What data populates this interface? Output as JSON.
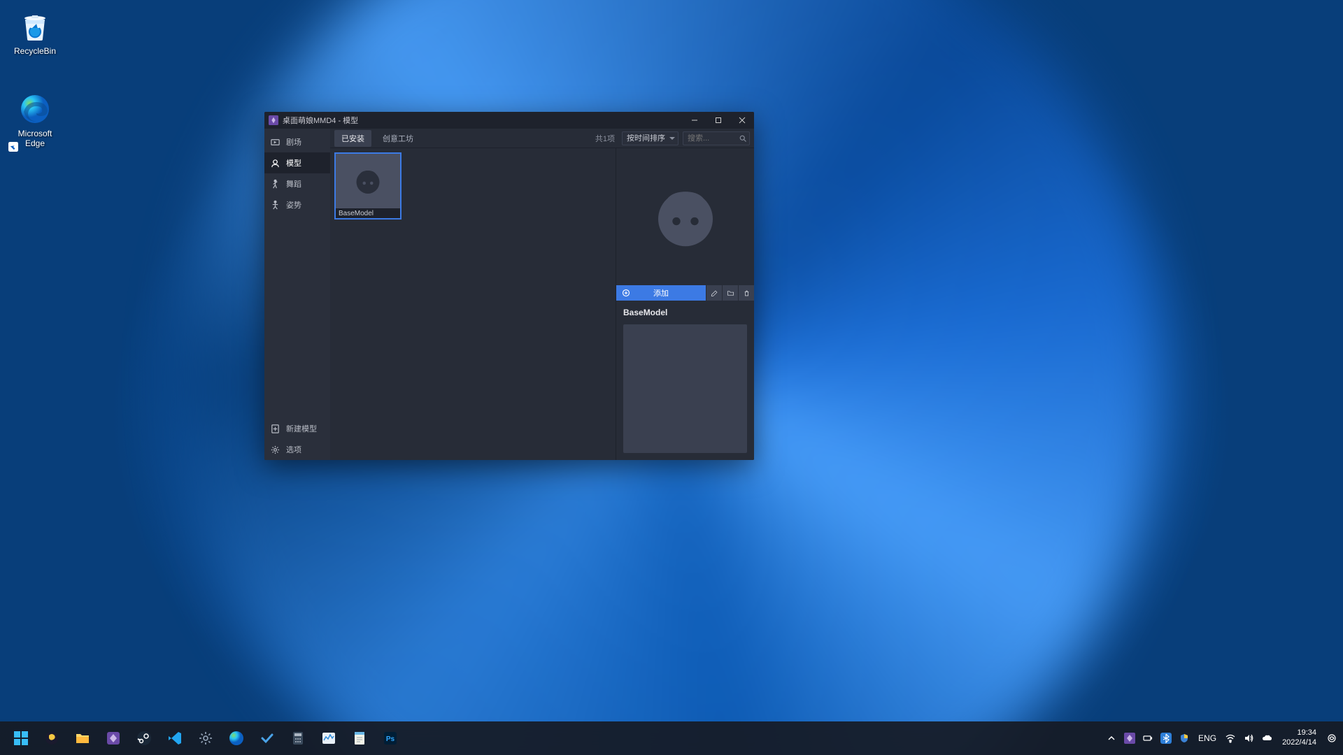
{
  "desktop": {
    "recycle_bin": "RecycleBin",
    "edge": "Microsoft Edge"
  },
  "window": {
    "title": "桌面萌娘MMD4 - 模型",
    "sidebar": {
      "scene": "剧场",
      "model": "模型",
      "dance": "舞蹈",
      "pose": "姿势",
      "new_model": "新建模型",
      "options": "选项"
    },
    "tabs": {
      "installed": "已安装",
      "workshop": "创意工坊"
    },
    "count_text": "共1项",
    "sort_label": "按时间排序",
    "search_placeholder": "搜索...",
    "grid": {
      "model_name": "BaseModel"
    },
    "detail": {
      "add_label": "添加",
      "title": "BaseModel"
    }
  },
  "taskbar": {
    "lang": "ENG",
    "time": "19:34",
    "date": "2022/4/14"
  }
}
